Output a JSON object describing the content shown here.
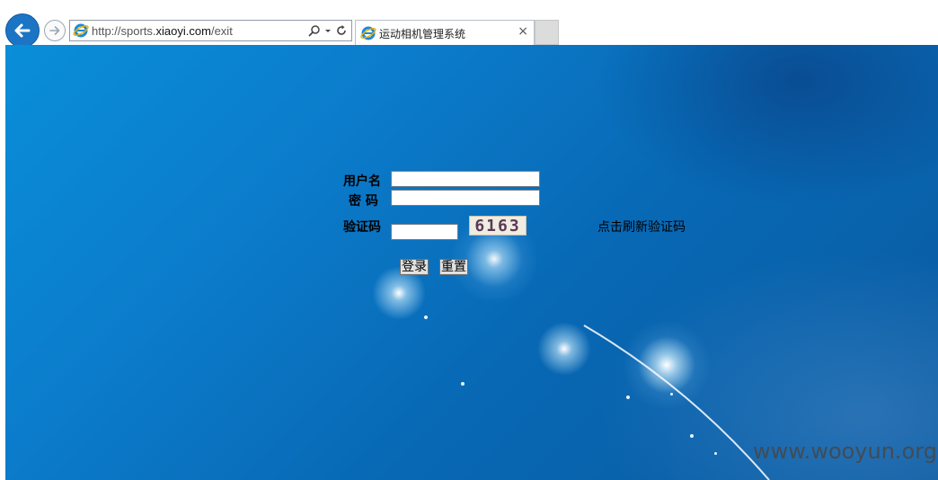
{
  "browser": {
    "address": {
      "prefix": "http://sports.",
      "host": "xiaoyi.com",
      "suffix": "/exit"
    },
    "tab": {
      "title": "运动相机管理系统",
      "close": "×"
    }
  },
  "login": {
    "username_label": "用户名",
    "password_label": "密 码",
    "captcha_label": "验证码",
    "captcha_code": "6163",
    "refresh_captcha": "点击刷新验证码",
    "login_button": "登录",
    "reset_button": "重置"
  },
  "watermark": "www.wooyun.org",
  "colors": {
    "background_top": "#0a8ed8",
    "background_bottom": "#0a5aa0",
    "back_button": "#1c75c4"
  },
  "icons": [
    "back-arrow-icon",
    "forward-arrow-icon",
    "ie-logo-icon",
    "search-icon",
    "dropdown-icon",
    "refresh-icon",
    "close-icon"
  ]
}
